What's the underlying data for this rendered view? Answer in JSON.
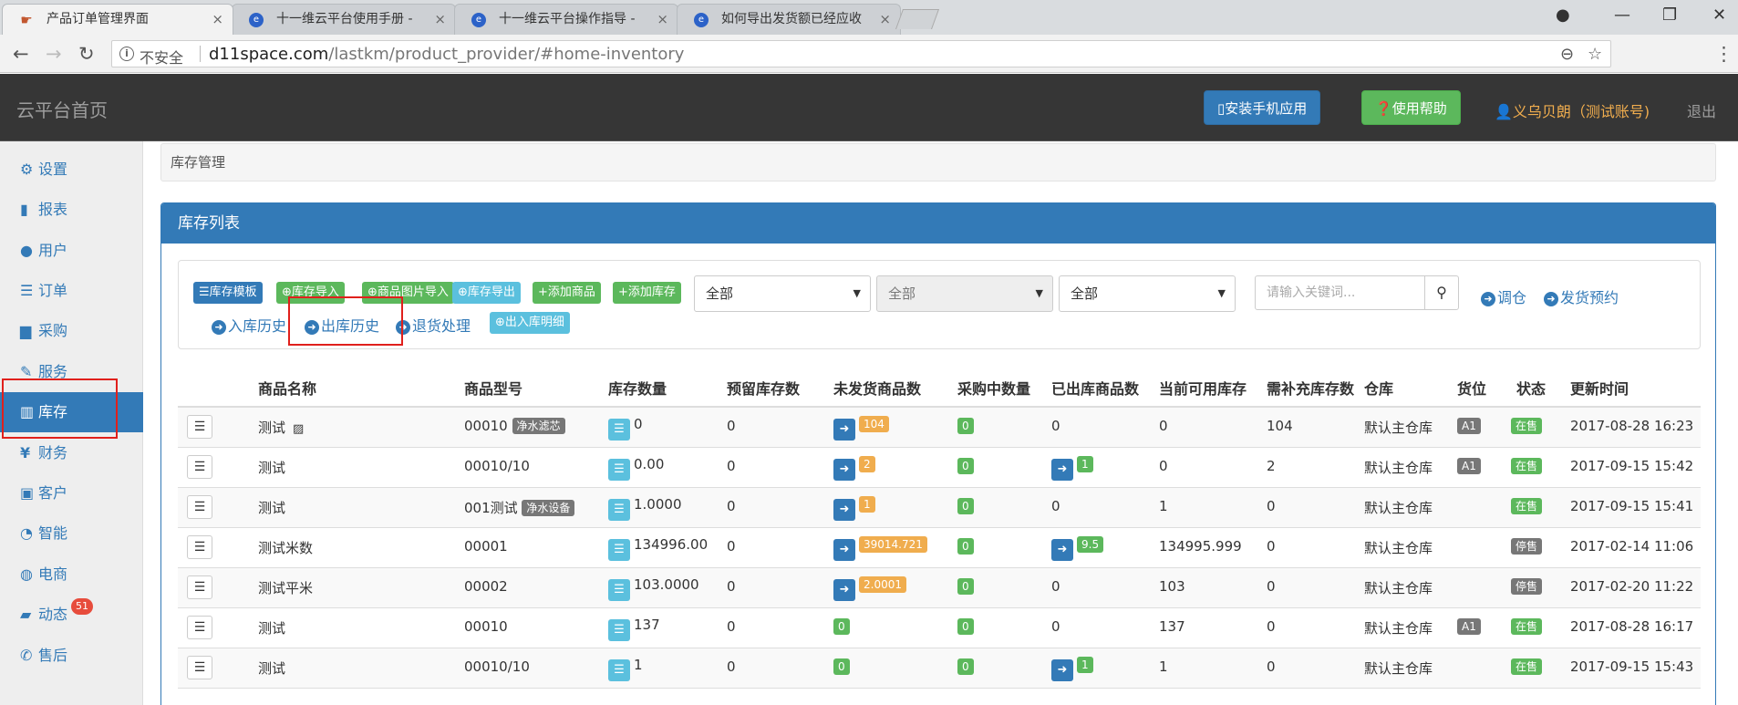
{
  "browser": {
    "tabs": [
      {
        "label": "产品订单管理界面"
      },
      {
        "label": "十一维云平台使用手册 -"
      },
      {
        "label": "十一维云平台操作指导 -"
      },
      {
        "label": "如何导出发货额已经应收"
      }
    ],
    "address": {
      "insecure_label": "不安全",
      "host": "d11space.com",
      "path": "/lastkm/product_provider/#home-inventory"
    }
  },
  "header": {
    "brand": "云平台首页",
    "install_app": "安装手机应用",
    "help": "使用帮助",
    "user": "义乌贝朗（测试账号)",
    "logout": "退出"
  },
  "sidebar": {
    "items": [
      {
        "label": "设置",
        "icon": "gear-icon"
      },
      {
        "label": "报表",
        "icon": "bar-chart-icon"
      },
      {
        "label": "用户",
        "icon": "user-icon"
      },
      {
        "label": "订单",
        "icon": "list-icon"
      },
      {
        "label": "采购",
        "icon": "cart-icon"
      },
      {
        "label": "服务",
        "icon": "wrench-icon"
      },
      {
        "label": "库存",
        "icon": "barcode-icon"
      },
      {
        "label": "财务",
        "icon": "yen-icon"
      },
      {
        "label": "客户",
        "icon": "briefcase-icon"
      },
      {
        "label": "智能",
        "icon": "dashboard-icon"
      },
      {
        "label": "电商",
        "icon": "globe-icon"
      },
      {
        "label": "动态",
        "icon": "comment-icon",
        "badge": "51"
      },
      {
        "label": "售后",
        "icon": "phone-icon"
      }
    ]
  },
  "breadcrumb": "库存管理",
  "panel": {
    "title": "库存列表"
  },
  "toolbar": {
    "buttons": [
      "库存模板",
      "库存导入",
      "商品图片导入",
      "库存导出",
      "添加商品",
      "添加库存"
    ],
    "select1": "全部",
    "select2": "全部",
    "select3": "全部",
    "search_placeholder": "请输入关键词...",
    "links": [
      "调仓",
      "发货预约",
      "入库历史",
      "出库历史",
      "退货处理"
    ],
    "detail_button": "出入库明细"
  },
  "table": {
    "headers": [
      "商品名称",
      "商品型号",
      "库存数量",
      "预留库存数",
      "未发货商品数",
      "采购中数量",
      "已出库商品数",
      "当前可用库存",
      "需补充库存数",
      "仓库",
      "货位",
      "状态",
      "更新时间"
    ],
    "rows": [
      {
        "name": "测试",
        "model": "00010",
        "model_tag": "净水滤芯",
        "stock": "0",
        "reserved": "0",
        "unshipped": "104",
        "purchasing": "0",
        "outbound": "0",
        "available": "0",
        "replenish": "104",
        "warehouse": "默认主仓库",
        "slot": "A1",
        "status": "在售",
        "updated": "2017-08-28 16:23"
      },
      {
        "name": "测试",
        "model": "00010/10",
        "model_tag": "",
        "stock": "0.00",
        "reserved": "0",
        "unshipped": "2",
        "purchasing": "0",
        "outbound": "1",
        "available": "0",
        "replenish": "2",
        "warehouse": "默认主仓库",
        "slot": "A1",
        "status": "在售",
        "updated": "2017-09-15 15:42"
      },
      {
        "name": "测试",
        "model": "001测试",
        "model_tag": "净水设备",
        "stock": "1.0000",
        "reserved": "0",
        "unshipped": "1",
        "purchasing": "0",
        "outbound": "0",
        "available": "1",
        "replenish": "0",
        "warehouse": "默认主仓库",
        "slot": "",
        "status": "在售",
        "updated": "2017-09-15 15:41"
      },
      {
        "name": "测试米数",
        "model": "00001",
        "model_tag": "",
        "stock": "134996.00",
        "reserved": "0",
        "unshipped": "39014.721",
        "purchasing": "0",
        "outbound": "9.5",
        "available": "134995.999",
        "replenish": "0",
        "warehouse": "默认主仓库",
        "slot": "",
        "status": "停售",
        "updated": "2017-02-14 11:06"
      },
      {
        "name": "测试平米",
        "model": "00002",
        "model_tag": "",
        "stock": "103.0000",
        "reserved": "0",
        "unshipped": "2.0001",
        "purchasing": "0",
        "outbound": "0",
        "available": "103",
        "replenish": "0",
        "warehouse": "默认主仓库",
        "slot": "",
        "status": "停售",
        "updated": "2017-02-20 11:22"
      },
      {
        "name": "测试",
        "model": "00010",
        "model_tag": "",
        "stock": "137",
        "reserved": "0",
        "unshipped": "0",
        "purchasing": "0",
        "outbound": "0",
        "available": "137",
        "replenish": "0",
        "warehouse": "默认主仓库",
        "slot": "A1",
        "status": "在售",
        "updated": "2017-08-28 16:17"
      },
      {
        "name": "测试",
        "model": "00010/10",
        "model_tag": "",
        "stock": "1",
        "reserved": "0",
        "unshipped": "0",
        "purchasing": "0",
        "outbound": "1",
        "available": "1",
        "replenish": "0",
        "warehouse": "默认主仓库",
        "slot": "",
        "status": "在售",
        "updated": "2017-09-15 15:43"
      }
    ]
  }
}
